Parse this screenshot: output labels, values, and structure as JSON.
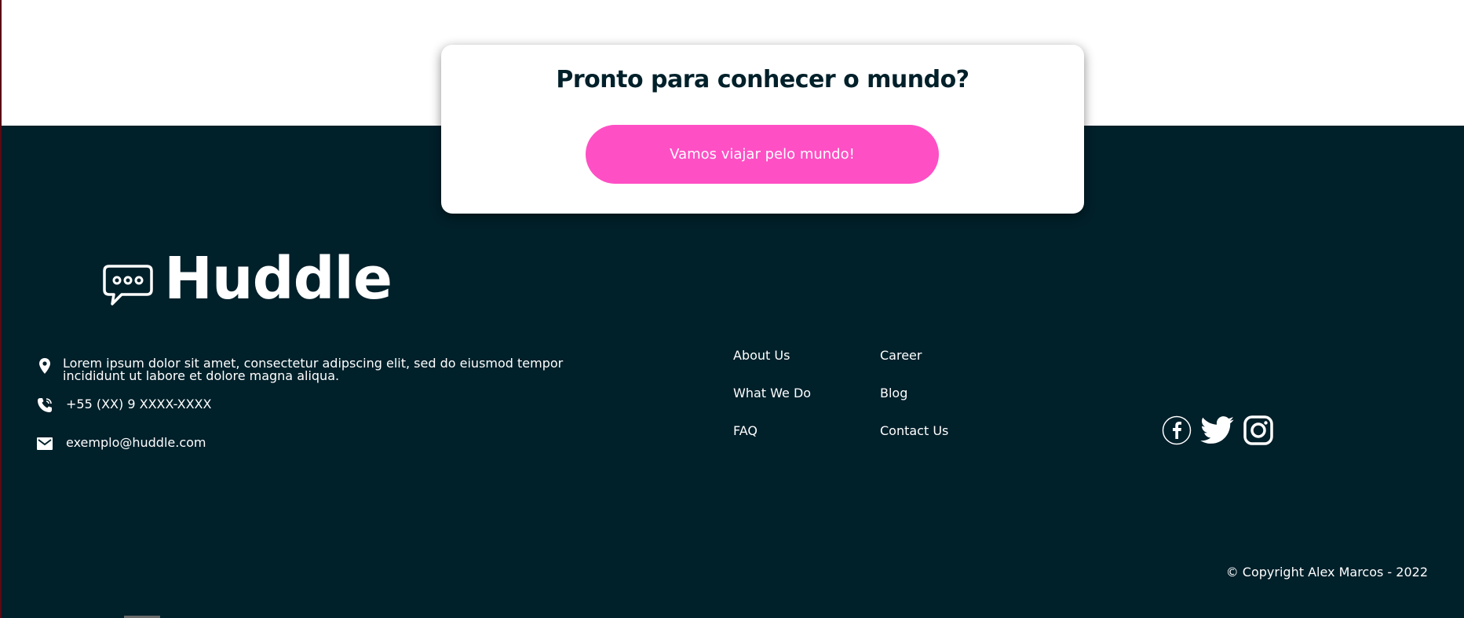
{
  "cta": {
    "title": "Pronto para conhecer o mundo?",
    "button_label": "Vamos viajar pelo mundo!"
  },
  "brand": {
    "name": "Huddle",
    "logo_icon": "chat-bubble-icon"
  },
  "contact": {
    "address": "Lorem ipsum dolor sit amet, consectetur adipscing elit, sed do eiusmod tempor incididunt ut labore et dolore magna aliqua.",
    "phone": "+55 (XX) 9 XXXX-XXXX",
    "email": "exemplo@huddle.com",
    "icons": [
      "location-pin-icon",
      "phone-icon",
      "mail-icon"
    ]
  },
  "nav": {
    "col1": [
      "About Us",
      "What We Do",
      "FAQ"
    ],
    "col2": [
      "Career",
      "Blog",
      "Contact Us"
    ]
  },
  "social": [
    "facebook-icon",
    "twitter-icon",
    "instagram-icon"
  ],
  "copyright": "© Copyright Alex Marcos - 2022",
  "colors": {
    "footer_bg": "#00202a",
    "accent": "#ff4fc5",
    "card_bg": "#ffffff",
    "text_light": "#ffffff",
    "text_dark": "#00202a"
  }
}
